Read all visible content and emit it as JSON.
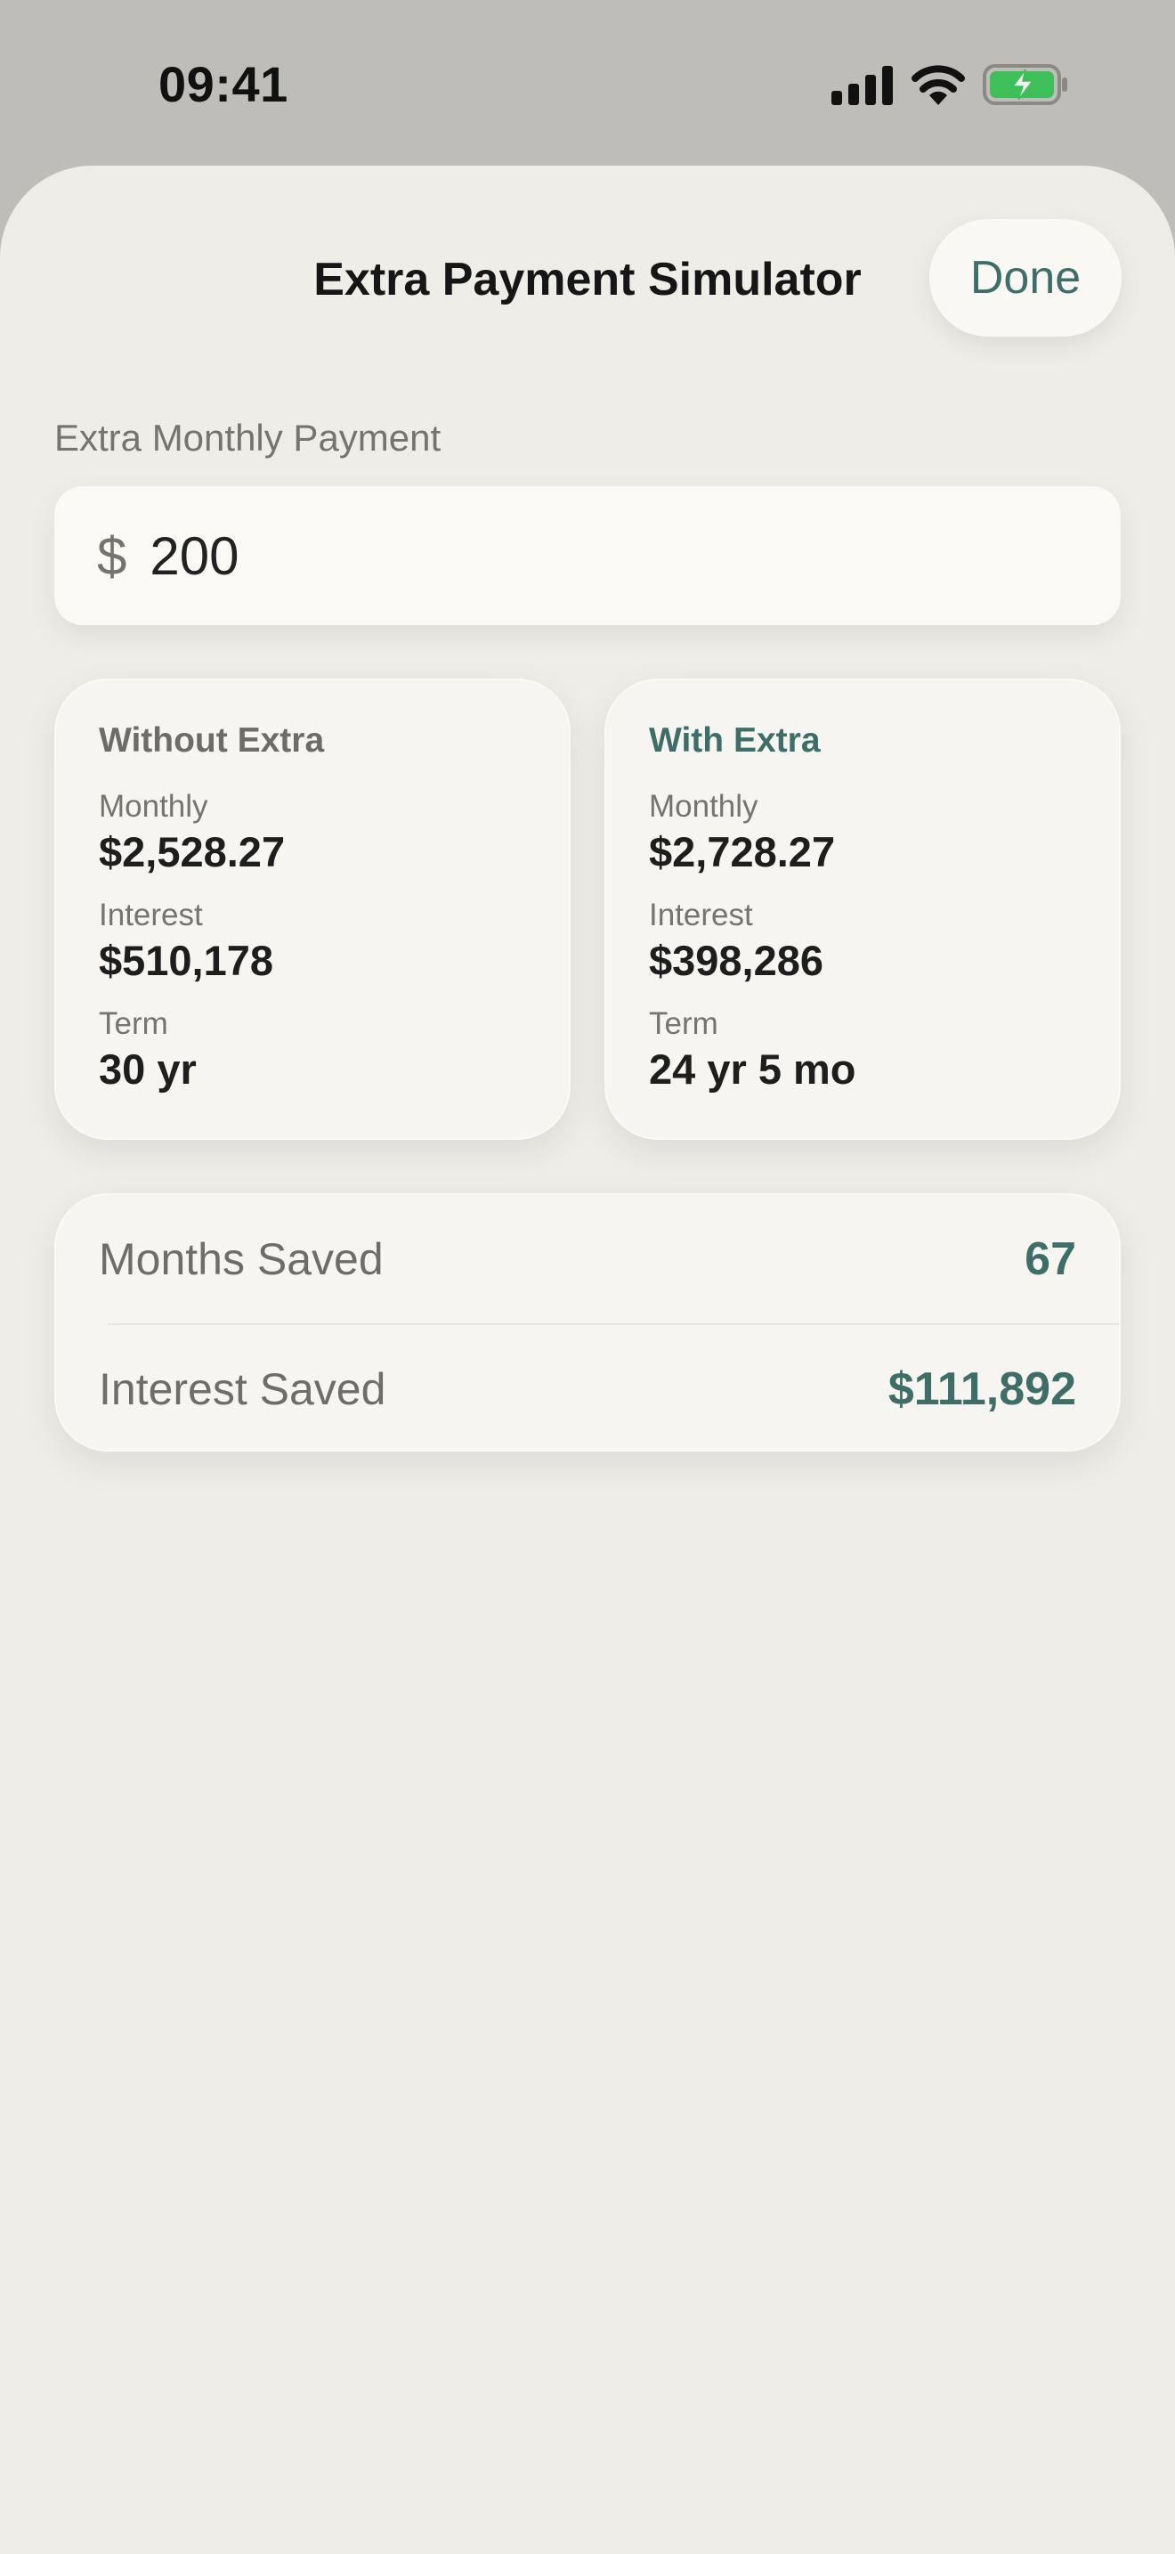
{
  "status_bar": {
    "time": "09:41",
    "icons": [
      "signal-icon",
      "wifi-icon",
      "battery-charging-icon"
    ],
    "battery_color": "#3fbf5a"
  },
  "header": {
    "title": "Extra Payment Simulator",
    "done_label": "Done"
  },
  "extra_payment": {
    "label": "Extra Monthly Payment",
    "currency": "$",
    "value": "200"
  },
  "without_extra": {
    "title": "Without Extra",
    "monthly_label": "Monthly",
    "monthly_value": "$2,528.27",
    "interest_label": "Interest",
    "interest_value": "$510,178",
    "term_label": "Term",
    "term_value": "30 yr"
  },
  "with_extra": {
    "title": "With Extra",
    "monthly_label": "Monthly",
    "monthly_value": "$2,728.27",
    "interest_label": "Interest",
    "interest_value": "$398,286",
    "term_label": "Term",
    "term_value": "24 yr 5 mo"
  },
  "savings": {
    "months_label": "Months Saved",
    "months_value": "67",
    "interest_label": "Interest Saved",
    "interest_value": "$111,892"
  },
  "colors": {
    "accent": "#3f6e68",
    "sheet_background": "#efede8",
    "card_background": "#f6f5f1"
  }
}
